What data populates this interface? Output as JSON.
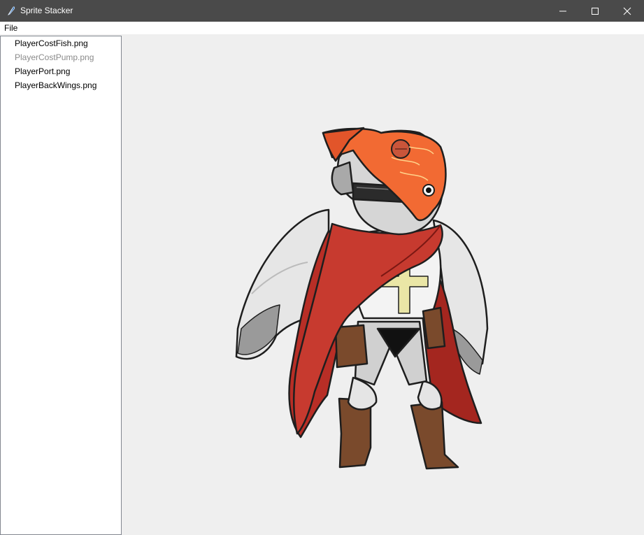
{
  "window": {
    "title": "Sprite Stacker",
    "icon": "feather-icon",
    "controls": [
      "minimize-icon",
      "maximize-icon",
      "close-icon"
    ]
  },
  "menubar": {
    "items": [
      {
        "label": "File"
      }
    ]
  },
  "file_list": {
    "items": [
      {
        "label": "PlayerCostFish.png",
        "state": "enabled"
      },
      {
        "label": "PlayerCostPump.png",
        "state": "disabled"
      },
      {
        "label": "PlayerPort.png",
        "state": "enabled"
      },
      {
        "label": "PlayerBackWings.png",
        "state": "enabled"
      }
    ]
  },
  "preview": {
    "subject": "knight-sprite",
    "colors": {
      "cape": "#b82e26",
      "fish": "#f26a33",
      "armor": "#d9d9d9",
      "boots": "#7a4a2c",
      "cross": "#eae6a6",
      "wings": "#e4e4e4"
    }
  }
}
